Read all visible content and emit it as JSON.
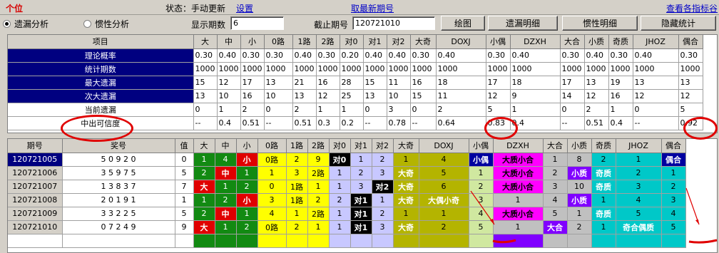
{
  "header": {
    "title": "个位",
    "status_label": "状态：",
    "status_value": "手动更新",
    "settings_link": "设置",
    "latest_link": "取最新期号",
    "view_index_link": "查看各指标谷"
  },
  "toolbar": {
    "radio_omission": "遗漏分析",
    "radio_inertia": "惯性分析",
    "periods_label": "显示期数",
    "periods_value": "6",
    "cutoff_label": "截止期号",
    "cutoff_value": "120721010",
    "btn_plot": "绘图",
    "btn_omission_detail": "遗漏明细",
    "btn_inertia_detail": "惯性明细",
    "btn_hide_stats": "隐藏统计"
  },
  "columns": [
    "大",
    "中",
    "小",
    "0路",
    "1路",
    "2路",
    "对0",
    "对1",
    "对2",
    "大奇",
    "DOXJ",
    "小偶",
    "DZXH",
    "大合",
    "小质",
    "奇质",
    "JHOZ",
    "偶合"
  ],
  "stats": {
    "header_label": "项目",
    "rows": [
      {
        "label": "理论概率",
        "values": [
          "0.30",
          "0.40",
          "0.30",
          "0.30",
          "0.40",
          "0.30",
          "0.20",
          "0.40",
          "0.40",
          "0.30",
          "0.40",
          "0.30",
          "0.40",
          "0.30",
          "0.40",
          "0.30",
          "0.40",
          "0.30"
        ]
      },
      {
        "label": "统计期数",
        "values": [
          "1000",
          "1000",
          "1000",
          "1000",
          "1000",
          "1000",
          "1000",
          "1000",
          "1000",
          "1000",
          "1000",
          "1000",
          "1000",
          "1000",
          "1000",
          "1000",
          "1000",
          "1000"
        ]
      },
      {
        "label": "最大遗漏",
        "values": [
          "15",
          "12",
          "17",
          "13",
          "21",
          "16",
          "28",
          "15",
          "11",
          "16",
          "18",
          "17",
          "18",
          "17",
          "13",
          "19",
          "13",
          "13"
        ]
      },
      {
        "label": "次大遗漏",
        "values": [
          "13",
          "10",
          "16",
          "10",
          "13",
          "12",
          "25",
          "13",
          "10",
          "15",
          "11",
          "12",
          "9",
          "14",
          "12",
          "16",
          "12",
          "12"
        ]
      },
      {
        "label": "当前遗漏",
        "values": [
          "0",
          "1",
          "2",
          "0",
          "2",
          "1",
          "1",
          "0",
          "3",
          "0",
          "2",
          "5",
          "1",
          "0",
          "2",
          "1",
          "0",
          "5"
        ]
      },
      {
        "label": "中出可信度",
        "values": [
          "--",
          "0.4",
          "0.51",
          "--",
          "0.51",
          "0.3",
          "0.2",
          "--",
          "0.78",
          "--",
          "0.64",
          "0.83",
          "0.4",
          "--",
          "0.51",
          "0.4",
          "--",
          "0.92"
        ]
      }
    ]
  },
  "draws": {
    "h_period": "期号",
    "h_number": "奖号",
    "h_value": "值",
    "rows": [
      {
        "period": "120721005",
        "number": "5 0 9 2 0",
        "value": "0",
        "cells": [
          "1",
          "4",
          "小",
          "0路",
          "2",
          "9",
          "对0",
          "1",
          "2",
          "1",
          "4",
          "小偶",
          "大质小合",
          "1",
          "8",
          "2",
          "1",
          "偶合"
        ]
      },
      {
        "period": "120721006",
        "number": "3 5 9 7 5",
        "value": "5",
        "cells": [
          "2",
          "中",
          "1",
          "1",
          "3",
          "2路",
          "1",
          "2",
          "3",
          "大奇",
          "5",
          "1",
          "大质小合",
          "2",
          "小质",
          "奇质",
          "2",
          "1"
        ]
      },
      {
        "period": "120721007",
        "number": "1 3 8 3 7",
        "value": "7",
        "cells": [
          "大",
          "1",
          "2",
          "0",
          "1路",
          "1",
          "1",
          "3",
          "对2",
          "大奇",
          "6",
          "2",
          "大质小合",
          "3",
          "10",
          "奇质",
          "3",
          "2"
        ]
      },
      {
        "period": "120721008",
        "number": "2 0 1 9 1",
        "value": "1",
        "cells": [
          "1",
          "2",
          "小",
          "3",
          "1路",
          "2",
          "2",
          "对1",
          "1",
          "大奇",
          "大偶小奇",
          "3",
          "1",
          "4",
          "小质",
          "1",
          "4",
          "3"
        ]
      },
      {
        "period": "120721009",
        "number": "3 3 2 2 5",
        "value": "5",
        "cells": [
          "2",
          "中",
          "1",
          "4",
          "1",
          "2路",
          "1",
          "对1",
          "2",
          "1",
          "1",
          "4",
          "大质小合",
          "5",
          "1",
          "奇质",
          "5",
          "4"
        ]
      },
      {
        "period": "120721010",
        "number": "0 7 2 4 9",
        "value": "9",
        "cells": [
          "大",
          "1",
          "2",
          "0路",
          "2",
          "1",
          "1",
          "对1",
          "3",
          "大奇",
          "2",
          "5",
          "1",
          "大合",
          "2",
          "1",
          "奇合偶质",
          "5"
        ]
      }
    ]
  },
  "colors": {
    "dark_green": "#128a12",
    "red": "#e00000",
    "yellow": "#ffff00",
    "blue": "#0000ff",
    "lavender": "#c8c8ff",
    "black": "#000000",
    "olive": "#b4b400",
    "green_bg": "#d0e8a0",
    "magenta": "#ff00ff",
    "purple": "#8000ff",
    "gray": "#c0c0c0",
    "cyan": "#00c8c8",
    "navy": "#0000a0"
  }
}
